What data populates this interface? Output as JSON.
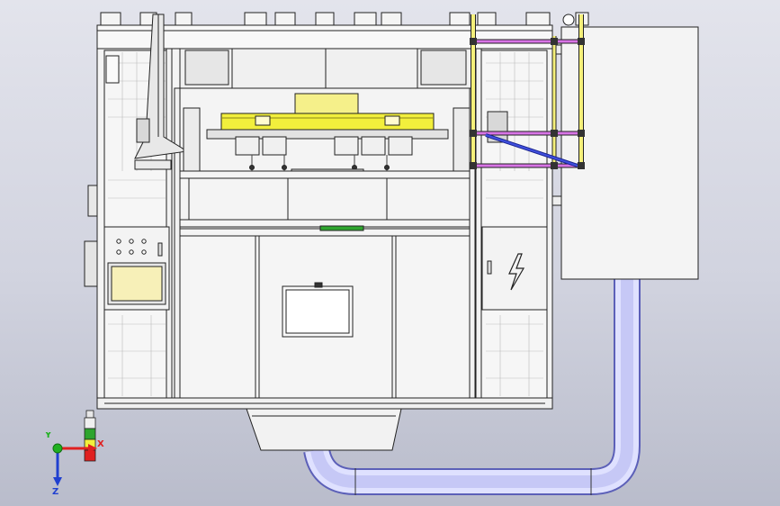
{
  "viewport": {
    "background_top": "#e3e4ec",
    "background_bottom": "#b9bccb"
  },
  "model": {
    "frame_color": "#f4f4f4",
    "line_color": "#222222",
    "gantry_color": "#f2ef3c",
    "yellow_rail_color": "#f5f07a",
    "magenta_rail_color": "#d874e6",
    "blue_strut_color": "#2f3fd0",
    "duct_color": "#c7c9f6",
    "screen_fill": "#f7f0b8",
    "indicator_color": "#2ea52e"
  },
  "triad": {
    "x_label": "X",
    "y_label": "Y",
    "z_label": "Z",
    "x_color": "#e02020",
    "y_color": "#20b020",
    "z_color": "#2040d0"
  },
  "icons": {
    "electrical_cabinet": "lightning-bolt-icon",
    "tower_light": "signal-tower-icon"
  }
}
